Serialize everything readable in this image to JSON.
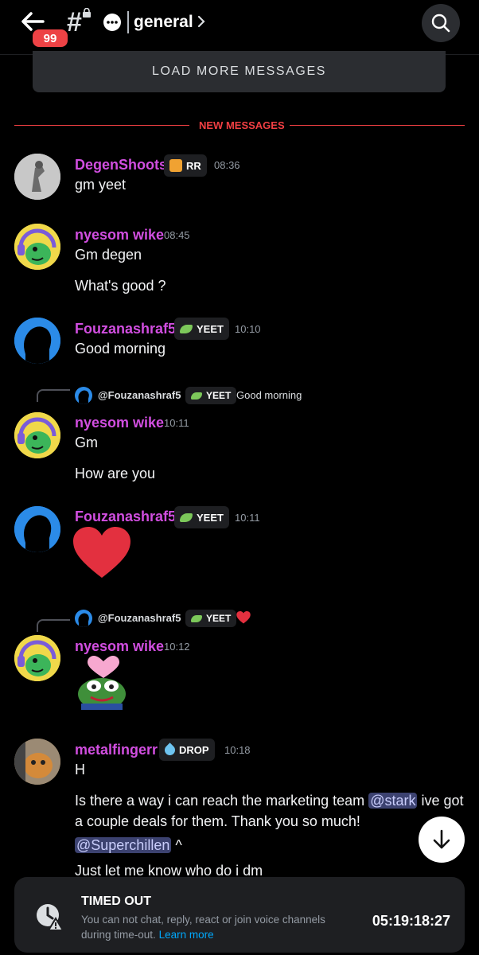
{
  "header": {
    "unread_count": "99",
    "channel_name": "general"
  },
  "load_more": "LOAD MORE MESSAGES",
  "new_messages_label": "NEW MESSAGES",
  "messages": [
    {
      "author": "DegenShoots",
      "tag": "RR",
      "time": "08:36",
      "lines": [
        "gm yeet"
      ]
    },
    {
      "author": "nyesom wike",
      "time": "08:45",
      "lines": [
        "Gm degen",
        "What's good ?"
      ]
    },
    {
      "author": "Fouzanashraf5",
      "tag": "YEET",
      "time": "10:10",
      "lines": [
        "Good morning"
      ]
    },
    {
      "reply": {
        "author": "@Fouzanashraf5",
        "tag": "YEET",
        "text": "Good morning"
      },
      "author": "nyesom wike",
      "time": "10:11",
      "lines": [
        "Gm",
        "How are you"
      ]
    },
    {
      "author": "Fouzanashraf5",
      "tag": "YEET",
      "time": "10:11",
      "emoji": "red-heart"
    },
    {
      "reply": {
        "author": "@Fouzanashraf5",
        "tag": "YEET",
        "emoji": "red-heart"
      },
      "author": "nyesom wike",
      "time": "10:12",
      "emoji": "pepe-love"
    },
    {
      "author": "metalfingerr",
      "tag": "DROP",
      "time": "10:18",
      "lines": [
        "H"
      ],
      "line2_a": "Is there a way i can reach the marketing team ",
      "line2_mention": "@stark",
      "line2_b": " ive got",
      "line3": "a couple deals for them. Thank you so much!",
      "line4_mention": "@Superchillen",
      "line4_b": " ^",
      "line5": "Just let me know who do i dm"
    }
  ],
  "timeout": {
    "title": "TIMED OUT",
    "desc": "You can not chat, reply, react or join voice channels during time-out.",
    "link": "Learn more",
    "timer": "05:19:18:27"
  },
  "colors": {
    "username": "#d14ee0",
    "new_messages": "#f23f43",
    "link": "#00a8fc",
    "mention_bg": "#3c4270"
  }
}
